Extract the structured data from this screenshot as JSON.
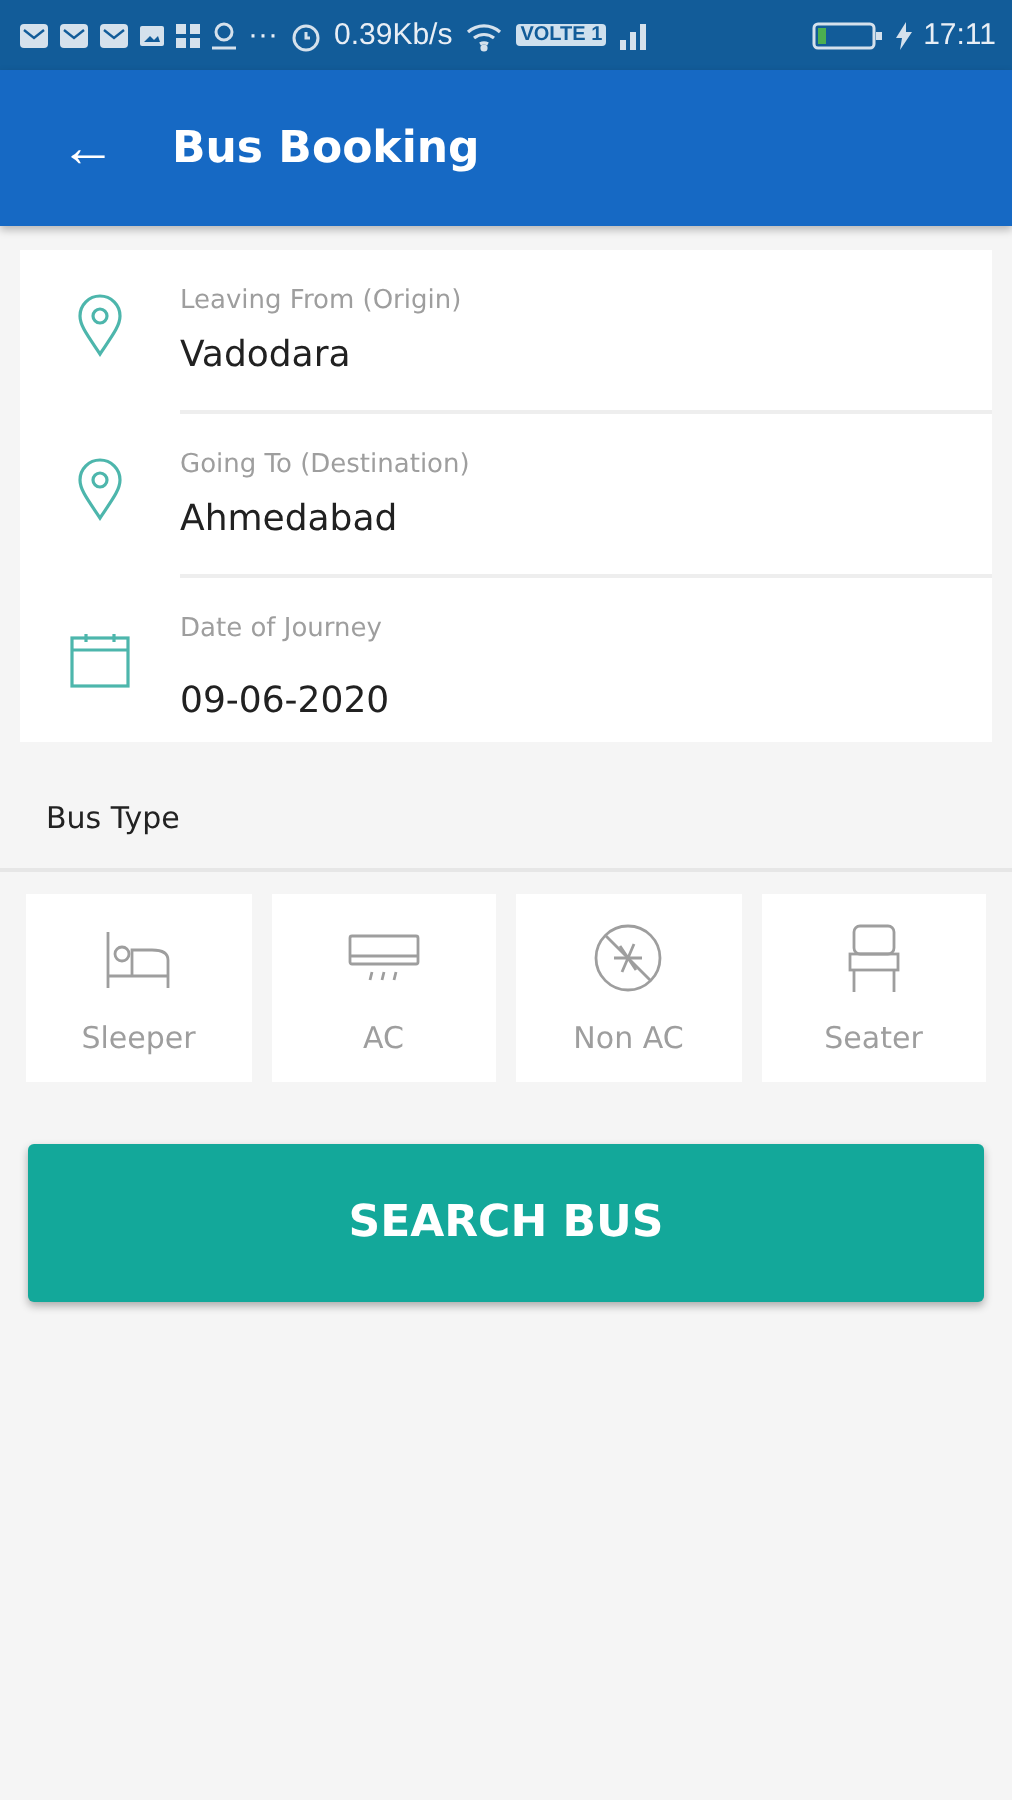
{
  "status_bar": {
    "network_speed": "0.39Kb/s",
    "volte_badge": "VOLTE 1",
    "time": "17:11",
    "overflow": "···"
  },
  "app_bar": {
    "back": "←",
    "title": "Bus Booking"
  },
  "fields": [
    {
      "kind": "location",
      "label": "Leaving From (Origin)",
      "value": "Vadodara"
    },
    {
      "kind": "location",
      "label": "Going To (Destination)",
      "value": "Ahmedabad"
    },
    {
      "kind": "date",
      "label": "Date of Journey",
      "value": "09-06-2020"
    }
  ],
  "bus_type": {
    "heading": "Bus Type",
    "options": [
      {
        "kind": "sleeper",
        "label": "Sleeper",
        "selected": false
      },
      {
        "kind": "ac",
        "label": "AC",
        "selected": false
      },
      {
        "kind": "non_ac",
        "label": "Non AC",
        "selected": false
      },
      {
        "kind": "seater",
        "label": "Seater",
        "selected": false
      }
    ]
  },
  "search_button": "SEARCH BUS"
}
